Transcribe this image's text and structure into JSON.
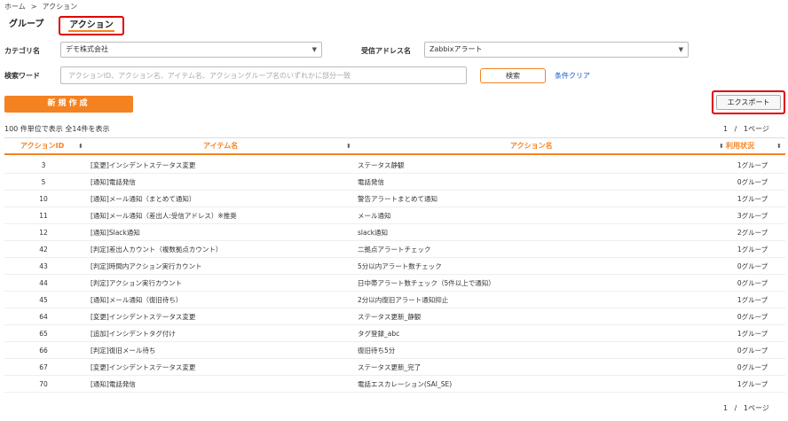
{
  "breadcrumb": {
    "home": "ホーム",
    "separator": ">",
    "current": "アクション"
  },
  "tabs": {
    "group": "グループ",
    "action": "アクション"
  },
  "filters": {
    "category_label": "カテゴリ名",
    "category_value": "デモ株式会社",
    "receive_label": "受信アドレス名",
    "receive_value": "Zabbixアラート",
    "keyword_label": "検索ワード",
    "keyword_placeholder": "アクションID、アクション名、アイテム名、アクショングループ名のいずれかに部分一致",
    "search_button": "検索",
    "clear_link": "条件クリア"
  },
  "toolbar": {
    "new_button": "新規作成",
    "export_button": "エクスポート"
  },
  "summary": "100 件単位で表示 全14件を表示",
  "pagination": {
    "current": "1",
    "separator": "/",
    "total": "1",
    "unit": "ページ"
  },
  "table": {
    "headers": {
      "id": "アクションID",
      "item": "アイテム名",
      "action": "アクション名",
      "status": "利用状況"
    },
    "rows": [
      {
        "id": "3",
        "item": "[変更]インシデントステータス変更",
        "action": "ステータス静観",
        "status": "1グループ"
      },
      {
        "id": "5",
        "item": "[通知]電話発信",
        "action": "電話発信",
        "status": "0グループ"
      },
      {
        "id": "10",
        "item": "[通知]メール通知（まとめて通知）",
        "action": "警告アラートまとめて通知",
        "status": "1グループ"
      },
      {
        "id": "11",
        "item": "[通知]メール通知（差出人:受信アドレス）※推奨",
        "action": "メール通知",
        "status": "3グループ"
      },
      {
        "id": "12",
        "item": "[通知]Slack通知",
        "action": "slack通知",
        "status": "2グループ"
      },
      {
        "id": "42",
        "item": "[判定]差出人カウント（複数拠点カウント）",
        "action": "二拠点アラートチェック",
        "status": "1グループ"
      },
      {
        "id": "43",
        "item": "[判定]時間内アクション実行カウント",
        "action": "5分以内アラート数チェック",
        "status": "0グループ"
      },
      {
        "id": "44",
        "item": "[判定]アクション実行カウント",
        "action": "日中帯アラート数チェック（5件以上で通知）",
        "status": "0グループ"
      },
      {
        "id": "45",
        "item": "[通知]メール通知（復旧待ち）",
        "action": "2分以内復旧アラート通知抑止",
        "status": "1グループ"
      },
      {
        "id": "64",
        "item": "[変更]インシデントステータス変更",
        "action": "ステータス更新_静観",
        "status": "0グループ"
      },
      {
        "id": "65",
        "item": "[追加]インシデントタグ付け",
        "action": "タグ登録_abc",
        "status": "1グループ"
      },
      {
        "id": "66",
        "item": "[判定]復旧メール待ち",
        "action": "復旧待ち5分",
        "status": "0グループ"
      },
      {
        "id": "67",
        "item": "[変更]インシデントステータス変更",
        "action": "ステータス更新_完了",
        "status": "0グループ"
      },
      {
        "id": "70",
        "item": "[通知]電話発信",
        "action": "電話エスカレーション(SAI_SE)",
        "status": "1グループ"
      }
    ]
  },
  "icons": {
    "sort": "sort-icon",
    "caret": "chevron-down-icon"
  },
  "colors": {
    "accent": "#f58220",
    "highlight": "#e00000",
    "link": "#1a5acc"
  }
}
